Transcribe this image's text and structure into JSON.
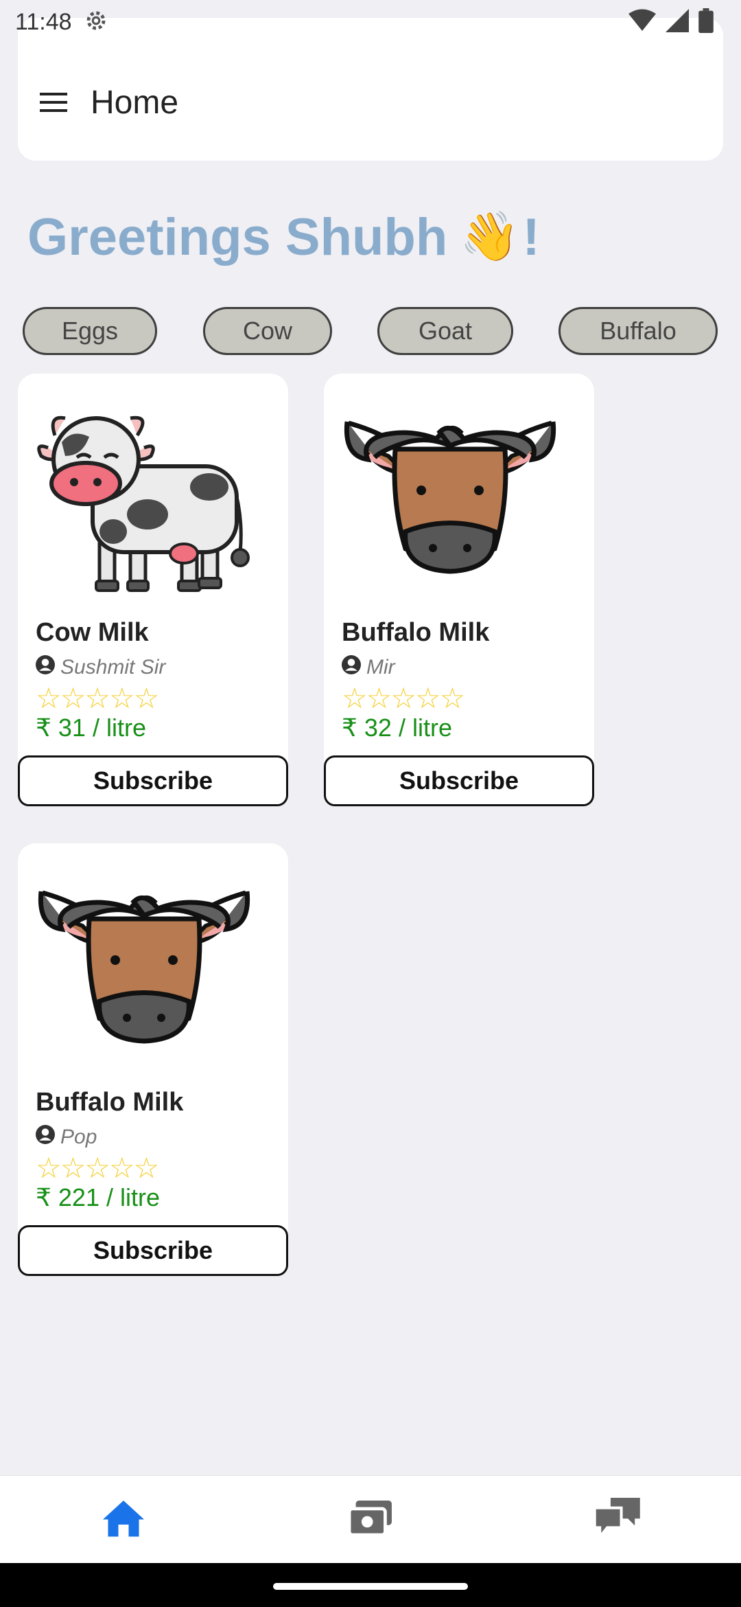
{
  "status_bar": {
    "time": "11:48",
    "icons": [
      "settings-icon",
      "wifi-icon",
      "signal-icon",
      "battery-icon"
    ]
  },
  "app_bar": {
    "title": "Home",
    "menu_icon": "menu-icon"
  },
  "greeting": {
    "text": "Greetings Shubh",
    "emoji": "👋",
    "suffix": "!",
    "color": "#8aaccc"
  },
  "categories": [
    "Eggs",
    "Cow",
    "Goat",
    "Buffalo"
  ],
  "products": [
    {
      "title": "Cow Milk",
      "seller": "Sushmit Sir",
      "stars": "☆☆☆☆☆",
      "rating": 0,
      "price": "₹ 31 / litre",
      "button": "Subscribe",
      "image": "cow-icon"
    },
    {
      "title": "Buffalo Milk",
      "seller": "Mir",
      "stars": "☆☆☆☆☆",
      "rating": 0,
      "price": "₹ 32 / litre",
      "button": "Subscribe",
      "image": "buffalo-icon"
    },
    {
      "title": "Buffalo Milk",
      "seller": "Pop",
      "stars": "☆☆☆☆☆",
      "rating": 0,
      "price": "₹ 221 / litre",
      "button": "Subscribe",
      "image": "buffalo-icon"
    }
  ],
  "bottom_nav": {
    "items": [
      "home-icon",
      "payments-icon",
      "chat-icon"
    ],
    "active": "home-icon",
    "active_color": "#1a73e8",
    "inactive_color": "#666666"
  },
  "colors": {
    "price": "#189018",
    "stars": "#f5d038",
    "chip_bg": "#c8c8c0"
  }
}
